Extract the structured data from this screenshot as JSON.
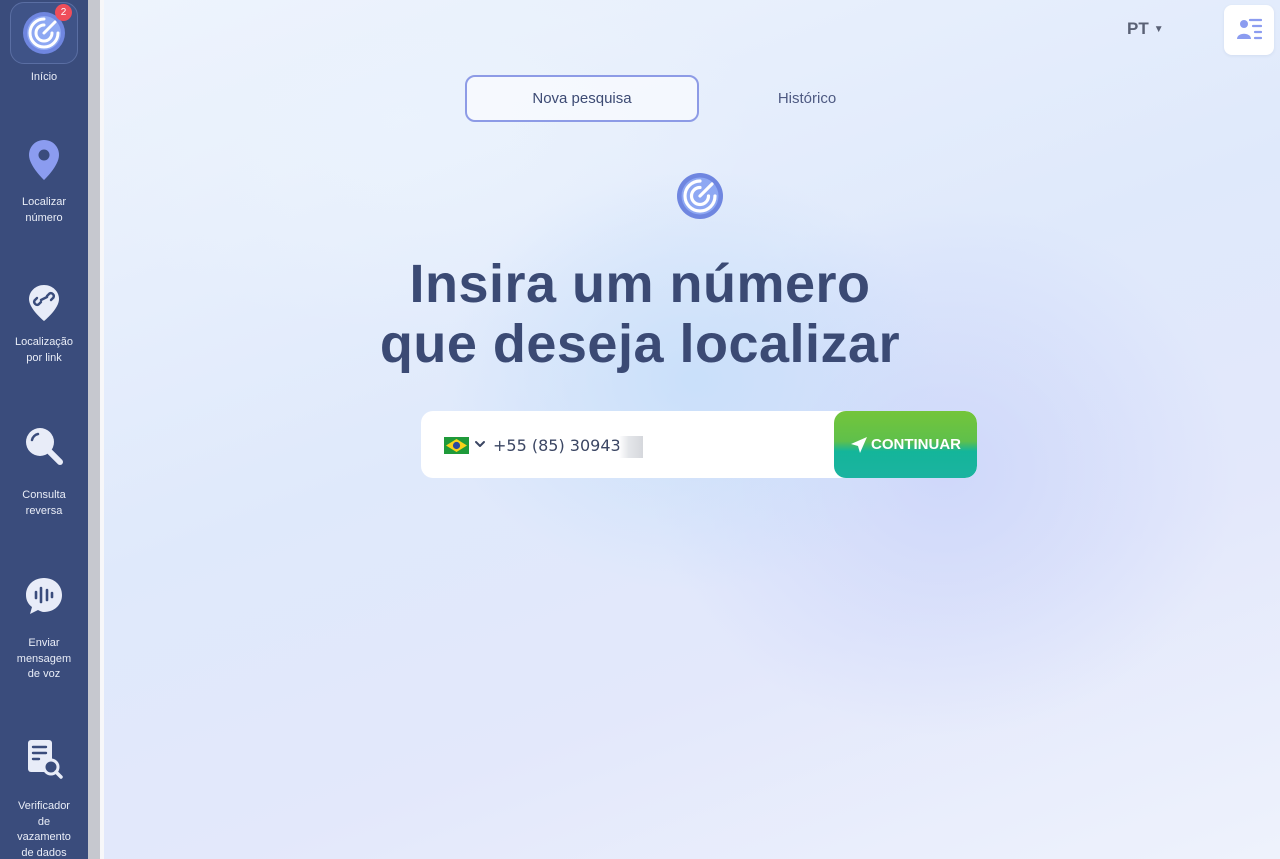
{
  "sidebar": {
    "home": {
      "label": "Início",
      "badge": "2"
    },
    "items": [
      {
        "label_lines": [
          "Localizar",
          "número"
        ],
        "icon": "location-pin-icon"
      },
      {
        "label_lines": [
          "Localização",
          "por link"
        ],
        "icon": "link-pin-icon"
      },
      {
        "label_lines": [
          "Consulta",
          "reversa"
        ],
        "icon": "magnifier-icon"
      },
      {
        "label_lines": [
          "Enviar",
          "mensagem",
          "de voz"
        ],
        "icon": "voice-message-icon"
      },
      {
        "label_lines": [
          "Verificador",
          "de",
          "vazamento",
          "de dados"
        ],
        "icon": "document-search-icon"
      }
    ]
  },
  "header": {
    "language": "PT",
    "profile_icon": "user-list-icon"
  },
  "tabs": {
    "new_search": "Nova pesquisa",
    "history": "Histórico"
  },
  "main": {
    "heading_line1": "Insira um número",
    "heading_line2": "que deseja localizar",
    "phone_value": "+55 (85) 30943",
    "country_flag": "brazil-flag-icon",
    "continue_label": "CONTINUAR"
  },
  "colors": {
    "sidebar": "#3a4c7c",
    "heading": "#3b4a74",
    "accent": "#8d9be6",
    "button_top": "#74c53a",
    "button_bottom": "#1bb3a0",
    "badge": "#ef4e5a"
  }
}
